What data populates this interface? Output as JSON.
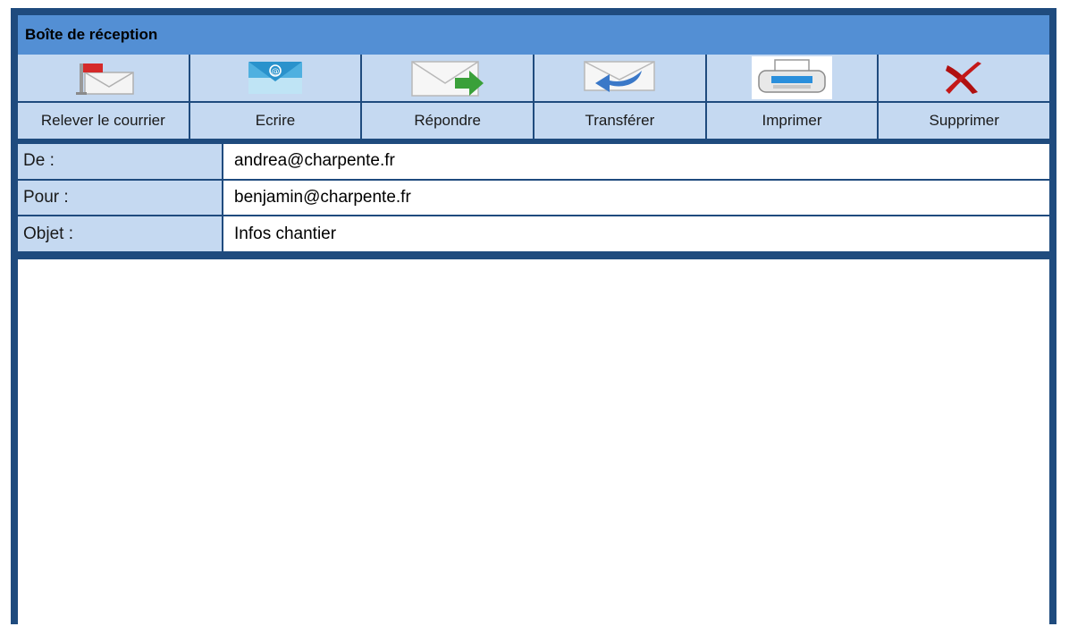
{
  "window": {
    "title": "Boîte de réception"
  },
  "toolbar": {
    "buttons": [
      {
        "label": "Relever le courrier",
        "icon": "mailbox-flag-icon"
      },
      {
        "label": "Ecrire",
        "icon": "at-envelope-icon"
      },
      {
        "label": "Répondre",
        "icon": "reply-envelope-icon"
      },
      {
        "label": "Transférer",
        "icon": "forward-envelope-icon"
      },
      {
        "label": "Imprimer",
        "icon": "printer-icon"
      },
      {
        "label": "Supprimer",
        "icon": "delete-x-icon"
      }
    ]
  },
  "message": {
    "from_label": "De :",
    "from_value": "andrea@charpente.fr",
    "to_label": "Pour :",
    "to_value": "benjamin@charpente.fr",
    "subject_label": "Objet :",
    "subject_value": "Infos chantier",
    "body": ""
  },
  "colors": {
    "frame": "#1f4b7e",
    "titlebar": "#538fd4",
    "cell": "#c5d9f1",
    "delete_red": "#b01010",
    "forward_green": "#3aa03a"
  }
}
